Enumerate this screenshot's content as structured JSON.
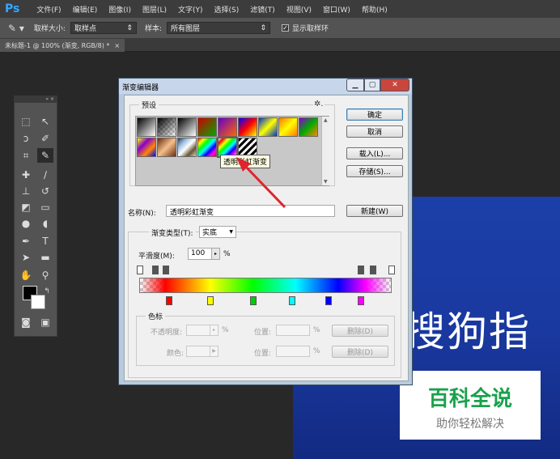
{
  "app": {
    "logo": "Ps"
  },
  "menubar": {
    "items": [
      "文件(F)",
      "编辑(E)",
      "图像(I)",
      "图层(L)",
      "文字(Y)",
      "选择(S)",
      "滤镜(T)",
      "视图(V)",
      "窗口(W)",
      "帮助(H)"
    ]
  },
  "options": {
    "sample_size_label": "取样大小:",
    "sample_size_value": "取样点",
    "sample_label": "样本:",
    "sample_value": "所有图层",
    "show_ring_label": "显示取样环"
  },
  "document_tab": {
    "title": "未标题-1 @ 100% (渐变, RGB/8) *",
    "close": "×"
  },
  "canvas": {
    "text": "搜狗指"
  },
  "watermark": {
    "title": "百科全说",
    "subtitle": "助你轻松解决"
  },
  "dialog": {
    "title": "渐变编辑器",
    "presets_label": "预设",
    "tooltip": "透明彩虹渐变",
    "buttons": {
      "ok": "确定",
      "cancel": "取消",
      "load": "载入(L)...",
      "save": "存储(S)...",
      "new": "新建(W)"
    },
    "name_label": "名称(N):",
    "name_value": "透明彩虹渐变",
    "gradient_type_label": "渐变类型(T):",
    "gradient_type_value": "实底",
    "smoothness_label": "平滑度(M):",
    "smoothness_value": "100",
    "smoothness_unit": "%",
    "color_stops": {
      "group_label": "色标",
      "opacity_label": "不透明度:",
      "opacity_unit": "%",
      "location_label": "位置:",
      "location_unit": "%",
      "color_label": "颜色:",
      "delete_label": "删除(D)"
    }
  },
  "colors": {
    "accent_arrow": "#e0242f",
    "canvas_blue": "#1a39a0",
    "watermark_green": "#1aa14c"
  }
}
